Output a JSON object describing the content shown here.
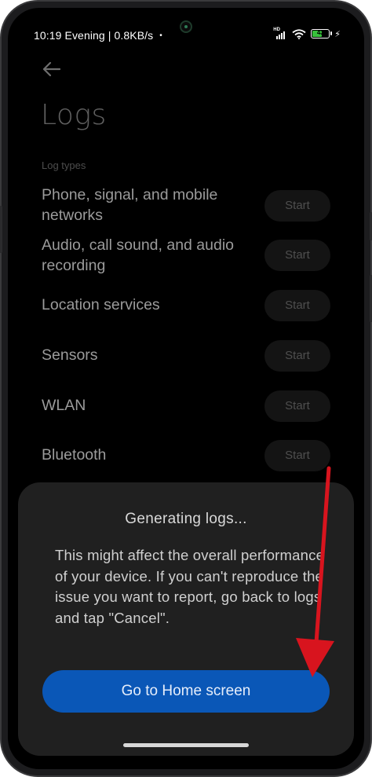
{
  "statusbar": {
    "left_text": "10:19 Evening | 0.8KB/s",
    "dot": "•",
    "network_badge": "HD",
    "battery_level": "43",
    "icons": [
      "signal-icon",
      "wifi-icon",
      "battery-icon",
      "charging-icon"
    ]
  },
  "header": {
    "back_icon": "back-arrow-icon",
    "title": "Logs"
  },
  "log_types": {
    "section_label": "Log types",
    "items": [
      {
        "label": "Phone, signal, and mobile networks",
        "button": "Start"
      },
      {
        "label": "Audio, call sound, and audio recording",
        "button": "Start"
      },
      {
        "label": "Location services",
        "button": "Start"
      },
      {
        "label": "Sensors",
        "button": "Start"
      },
      {
        "label": "WLAN",
        "button": "Start"
      },
      {
        "label": "Bluetooth",
        "button": "Start"
      }
    ]
  },
  "dialog": {
    "title": "Generating logs...",
    "body": "This might affect the overall performance of your device. If you can't reproduce the issue you want to report, go back to logs and tap \"Cancel\".",
    "primary_button": "Go to Home screen"
  },
  "colors": {
    "screen_bg": "#000000",
    "sheet_bg": "#202020",
    "primary_button": "#0a57b7",
    "annotation_arrow": "#d8141e",
    "battery_fill": "#37c13b"
  }
}
